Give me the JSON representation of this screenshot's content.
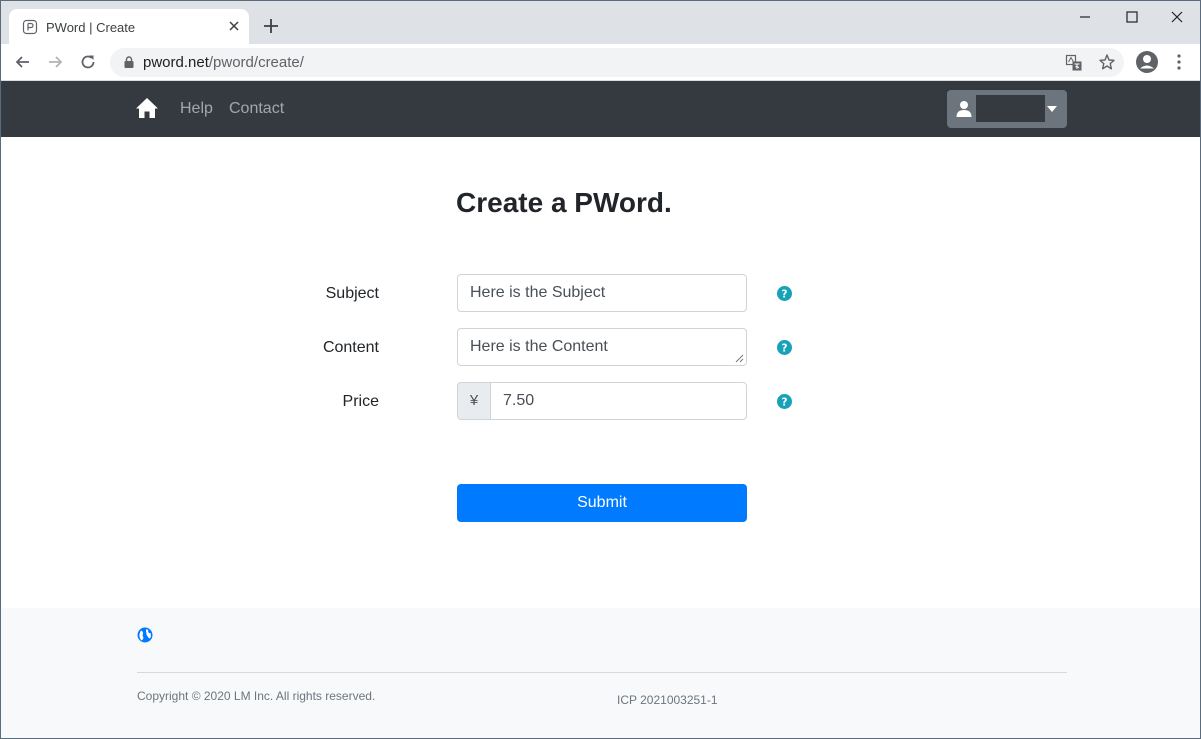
{
  "browser": {
    "tab_title": "PWord | Create",
    "url_host": "pword.net",
    "url_path": "/pword/create/"
  },
  "navbar": {
    "links": [
      {
        "label": "Help"
      },
      {
        "label": "Contact"
      }
    ],
    "user_name": ""
  },
  "form": {
    "title": "Create a PWord.",
    "subject": {
      "label": "Subject",
      "value": "Here is the Subject"
    },
    "content": {
      "label": "Content",
      "value": "Here is the Content"
    },
    "price": {
      "label": "Price",
      "currency": "¥",
      "value": "7.50"
    },
    "submit_label": "Submit"
  },
  "footer": {
    "copyright": "Copyright © 2020 LM Inc. All rights reserved.",
    "icp": "ICP 2021003251-1"
  },
  "colors": {
    "navbar_bg": "#343a40",
    "primary": "#007bff",
    "help_icon": "#17a2b8"
  }
}
